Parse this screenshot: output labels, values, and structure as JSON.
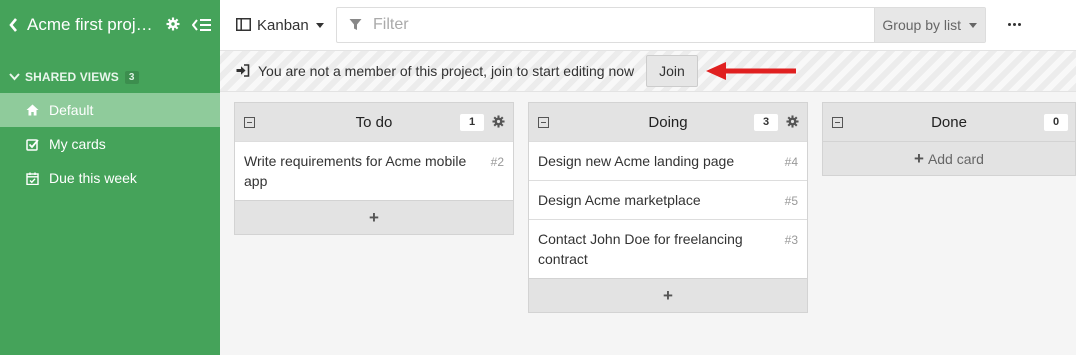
{
  "sidebar": {
    "project_title": "Acme first proj…",
    "section_label": "SHARED VIEWS",
    "section_count": "3",
    "items": [
      {
        "label": "Default",
        "icon": "home-icon",
        "active": true
      },
      {
        "label": "My cards",
        "icon": "check-square-icon",
        "active": false
      },
      {
        "label": "Due this week",
        "icon": "calendar-check-icon",
        "active": false
      }
    ]
  },
  "toolbar": {
    "view_label": "Kanban",
    "filter_placeholder": "Filter",
    "groupby_label": "Group by list"
  },
  "notice": {
    "message": "You are not a member of this project, join to start editing now",
    "join_label": "Join"
  },
  "lists": [
    {
      "title": "To do",
      "count": "1",
      "cards": [
        {
          "text": "Write requirements for Acme mobile app",
          "number": "#2"
        }
      ]
    },
    {
      "title": "Doing",
      "count": "3",
      "cards": [
        {
          "text": "Design new Acme landing page",
          "number": "#4"
        },
        {
          "text": "Design Acme marketplace",
          "number": "#5"
        },
        {
          "text": "Contact John Doe for freelancing contract",
          "number": "#3"
        }
      ]
    },
    {
      "title": "Done",
      "count": "0",
      "cards": [],
      "add_label": "Add card"
    }
  ],
  "colors": {
    "sidebar_bg": "#45a35a",
    "sidebar_active": "#8fcb9b",
    "arrow": "#e02020"
  }
}
